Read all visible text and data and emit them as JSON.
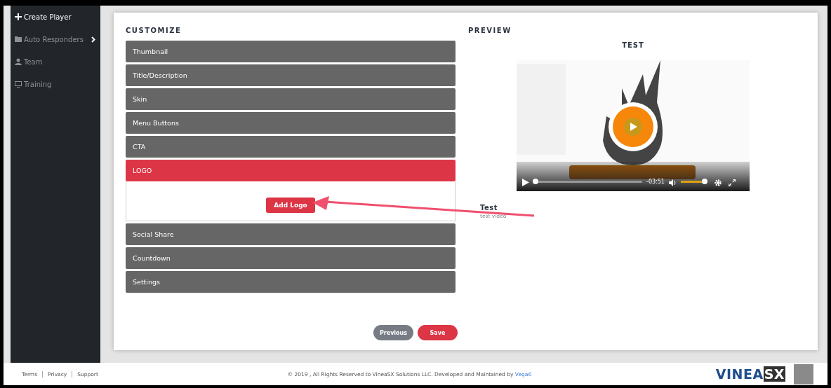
{
  "sidebar": {
    "items": [
      {
        "label": "Create Player",
        "selected": true,
        "has_submenu": false
      },
      {
        "label": "Auto Responders",
        "selected": false,
        "has_submenu": true
      },
      {
        "label": "Team",
        "selected": false,
        "has_submenu": false
      },
      {
        "label": "Training",
        "selected": false,
        "has_submenu": false
      }
    ]
  },
  "customize": {
    "title": "CUSTOMIZE",
    "sections": [
      {
        "label": "Thumbnail",
        "expanded": false
      },
      {
        "label": "Title/Description",
        "expanded": false
      },
      {
        "label": "Skin",
        "expanded": false
      },
      {
        "label": "Menu Buttons",
        "expanded": false
      },
      {
        "label": "CTA",
        "expanded": false
      },
      {
        "label": "LOGO",
        "expanded": true,
        "button": "Add Logo"
      },
      {
        "label": "Social Share",
        "expanded": false
      },
      {
        "label": "Countdown",
        "expanded": false
      },
      {
        "label": "Settings",
        "expanded": false
      }
    ],
    "buttons": [
      {
        "label": "Previous",
        "kind": "secondary"
      },
      {
        "label": "Save",
        "kind": "primary"
      }
    ]
  },
  "preview": {
    "title": "PREVIEW",
    "video_title": "TEST",
    "player": {
      "time": "-03:51",
      "progress": {
        "level": 0.02
      },
      "volume": {
        "level": 0.95
      }
    },
    "name": "Test",
    "description": "test video"
  },
  "footer": {
    "links": [
      "Terms",
      "Privacy",
      "Support"
    ],
    "copyright": "© 2019 , All Rights Reserved to VineaSX Solutions LLC. Developed and Maintained by ",
    "copyright_link": "Vega6",
    "logo": {
      "text": "VINEA",
      "badge": "SX"
    }
  }
}
